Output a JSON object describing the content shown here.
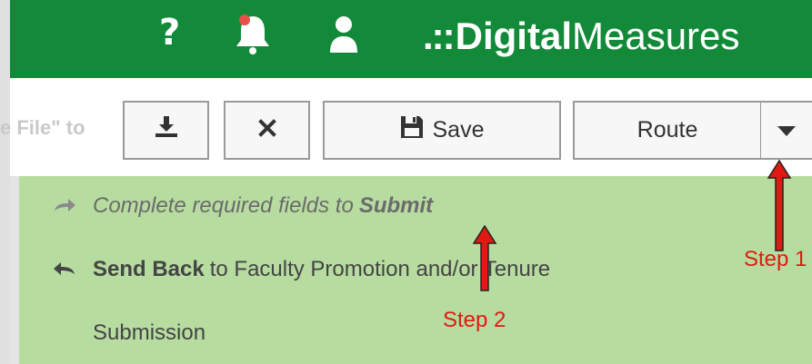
{
  "header": {
    "brand_dots": ".::",
    "brand_bold": "Digital",
    "brand_light": "Measures",
    "help_glyph": "?",
    "bg_color": "#128a3a"
  },
  "toolbar": {
    "faded_text": "e File\" to ",
    "save_label": "Save",
    "route_label": "Route"
  },
  "menu": {
    "bg_color": "#b7dca0",
    "submit_prefix": "Complete required fields to",
    "submit_strong": "Submit",
    "sendback_strong": "Send Back",
    "sendback_rest": "to Faculty Promotion and/or Tenure",
    "sendback_cont": "Submission"
  },
  "annotations": {
    "step1": "Step 1",
    "step2": "Step 2",
    "color": "#e01a12"
  }
}
